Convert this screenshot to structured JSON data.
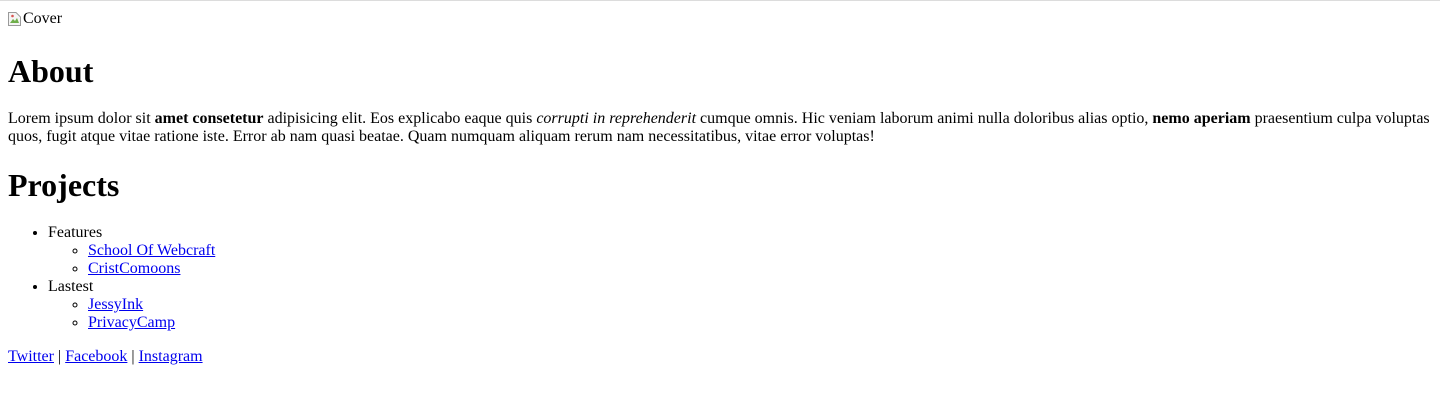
{
  "cover": {
    "alt": "Cover",
    "icon": "broken-image-icon"
  },
  "about": {
    "heading": "About",
    "text_1": "Lorem ipsum dolor sit ",
    "bold_1": "amet consetetur",
    "text_2": " adipisicing elit. Eos explicabo eaque quis ",
    "italic_1": "corrupti in reprehenderit",
    "text_3": " cumque omnis. Hic veniam laborum animi nulla doloribus alias optio, ",
    "bold_2": "nemo aperiam",
    "text_4": " praesentium culpa voluptas quos, fugit atque vitae ratione iste. Error ab nam quasi beatae. Quam numquam aliquam rerum nam necessitatibus, vitae error voluptas!"
  },
  "projects": {
    "heading": "Projects",
    "groups": [
      {
        "label": "Features",
        "links": [
          "School Of Webcraft",
          "CristComoons"
        ]
      },
      {
        "label": "Lastest",
        "links": [
          "JessyInk",
          "PrivacyCamp"
        ]
      }
    ]
  },
  "footer": {
    "links": [
      "Twitter",
      "Facebook",
      "Instagram"
    ],
    "separator": "|"
  },
  "colors": {
    "link": "#0000ee",
    "text": "#000000",
    "background": "#ffffff"
  }
}
